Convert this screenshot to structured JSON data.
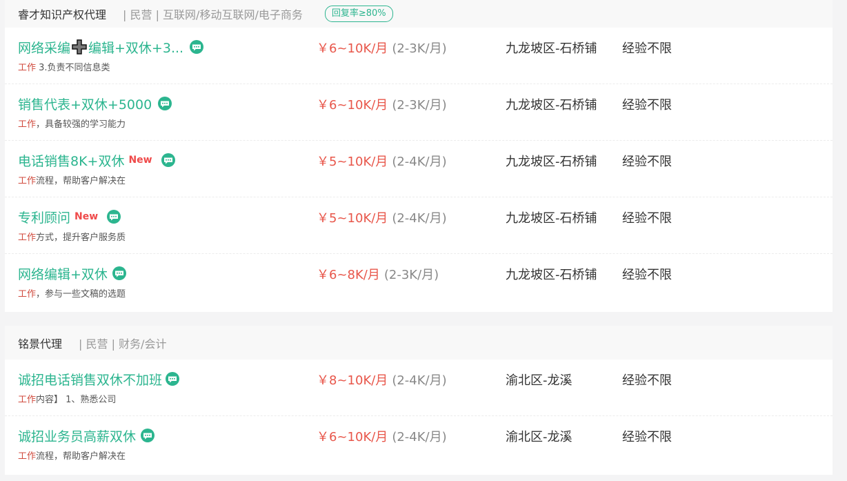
{
  "companies": [
    {
      "name": "睿才知识产权代理",
      "meta": "| 民营 | 互联网/移动互联网/电子商务",
      "badge": "回复率≥80%",
      "jobs": [
        {
          "title_a": "网络采编",
          "title_b": "编辑+双休+3...",
          "new": "",
          "kw": "工作",
          "desc": " 3.负责不同信息类",
          "salary": "￥6~10K/月",
          "salary_sub": "(2-3K/月)",
          "location": "九龙坡区-石桥铺",
          "exp": "经验不限"
        },
        {
          "title_a": "销售代表+双休+5000",
          "title_b": "",
          "new": "",
          "kw": "工作",
          "desc": "，具备较强的学习能力",
          "salary": "￥6~10K/月",
          "salary_sub": "(2-3K/月)",
          "location": "九龙坡区-石桥铺",
          "exp": "经验不限"
        },
        {
          "title_a": "电话销售8K+双休",
          "title_b": "",
          "new": "New",
          "kw": "工作",
          "desc": "流程，帮助客户解决在",
          "salary": "￥5~10K/月",
          "salary_sub": "(2-4K/月)",
          "location": "九龙坡区-石桥铺",
          "exp": "经验不限"
        },
        {
          "title_a": "专利顾问",
          "title_b": "",
          "new": "New",
          "kw": "工作",
          "desc": "方式，提升客户服务质",
          "salary": "￥5~10K/月",
          "salary_sub": "(2-4K/月)",
          "location": "九龙坡区-石桥铺",
          "exp": "经验不限"
        },
        {
          "title_a": "网络编辑+双休",
          "title_b": "",
          "new": "",
          "kw": "工作",
          "desc": "，参与一些文稿的选题",
          "salary": "￥6~8K/月",
          "salary_sub": "(2-3K/月)",
          "location": "九龙坡区-石桥铺",
          "exp": "经验不限"
        }
      ]
    },
    {
      "name": "铭景代理",
      "meta": "| 民营 | 财务/会计",
      "badge": "",
      "jobs": [
        {
          "title_a": "诚招电话销售双休不加班",
          "title_b": "",
          "new": "",
          "kw": "工作",
          "desc": "内容】 1、熟悉公司",
          "salary": "￥8~10K/月",
          "salary_sub": "(2-4K/月)",
          "location": "渝北区-龙溪",
          "exp": "经验不限"
        },
        {
          "title_a": "诚招业务员高薪双休",
          "title_b": "",
          "new": "",
          "kw": "工作",
          "desc": "流程，帮助客户解决在",
          "salary": "￥6~10K/月",
          "salary_sub": "(2-4K/月)",
          "location": "渝北区-龙溪",
          "exp": "经验不限"
        }
      ]
    }
  ],
  "colors": {
    "accent": "#2cb58f",
    "salary": "#e8564a",
    "new": "#ef4a4a"
  }
}
